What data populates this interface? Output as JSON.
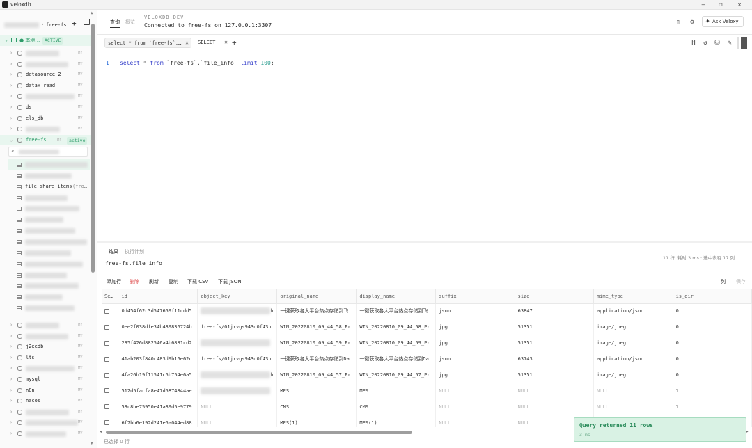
{
  "app": {
    "title": "veloxdb"
  },
  "window_controls": {
    "minimize": "—",
    "maximize": "❐",
    "close": "✕"
  },
  "sidebar": {
    "breadcrumb_db": "free-fs",
    "connection": {
      "name": "● 本地…",
      "tag": "ACTIVE"
    },
    "search_placeholder": "",
    "databases": [
      {
        "name": "",
        "blurred": true,
        "tag": "MY"
      },
      {
        "name": "",
        "blurred": true,
        "tag": "MY"
      },
      {
        "name": "datasource_2",
        "tag": "MY"
      },
      {
        "name": "datax_read",
        "tag": "MY"
      },
      {
        "name": "",
        "blurred": true,
        "tag": "MY"
      },
      {
        "name": "ds",
        "tag": "MY"
      },
      {
        "name": "els_db",
        "tag": "MY"
      },
      {
        "name": "",
        "blurred": true,
        "tag": "MY"
      },
      {
        "name": "free-fs",
        "tag": "MY",
        "active_label": "active",
        "expanded": true
      }
    ],
    "tables": [
      {
        "name": "",
        "blurred": true
      },
      {
        "name": "",
        "blurred": true
      },
      {
        "name": "file_share_items",
        "suffix": "(fro…"
      },
      {
        "name": "",
        "blurred": true
      },
      {
        "name": "",
        "blurred": true
      },
      {
        "name": "",
        "blurred": true
      },
      {
        "name": "",
        "blurred": true
      },
      {
        "name": "",
        "blurred": true
      },
      {
        "name": "",
        "blurred": true
      },
      {
        "name": "",
        "blurred": true
      },
      {
        "name": "",
        "blurred": true
      },
      {
        "name": "",
        "blurred": true
      },
      {
        "name": "",
        "blurred": true
      },
      {
        "name": "",
        "blurred": true
      }
    ],
    "databases_after": [
      {
        "name": "",
        "blurred": true,
        "tag": "MY"
      },
      {
        "name": "",
        "blurred": true,
        "tag": "MY"
      },
      {
        "name": "j2eedb",
        "tag": "MY"
      },
      {
        "name": "lts",
        "tag": "MY"
      },
      {
        "name": "",
        "blurred": true,
        "tag": "MY"
      },
      {
        "name": "mysql",
        "tag": "MY"
      },
      {
        "name": "n8n",
        "tag": "MY"
      },
      {
        "name": "nacos",
        "tag": "MY"
      },
      {
        "name": "",
        "blurred": true,
        "tag": "MY"
      },
      {
        "name": "",
        "blurred": true,
        "tag": "MY"
      },
      {
        "name": "",
        "blurred": true,
        "tag": "MY"
      }
    ]
  },
  "topbar": {
    "tab_query": "查询",
    "tab_overview": "概览",
    "brand": "VELOXDB.DEV",
    "connection_info": "Connected to free-fs on 127.0.0.1:3307",
    "ask_button": "Ask Veloxy"
  },
  "editor_tabs": [
    {
      "label": "select * from `free-fs`.…",
      "active": true
    },
    {
      "label": "SELECT",
      "active": false
    }
  ],
  "editor": {
    "line_number": "1",
    "sql_tokens": [
      {
        "t": "select",
        "c": "kw"
      },
      {
        "t": " ",
        "c": ""
      },
      {
        "t": "*",
        "c": "op"
      },
      {
        "t": " ",
        "c": ""
      },
      {
        "t": "from",
        "c": "kw"
      },
      {
        "t": " `free-fs`.`file_info` ",
        "c": ""
      },
      {
        "t": "limit",
        "c": "kw"
      },
      {
        "t": " ",
        "c": ""
      },
      {
        "t": "100",
        "c": "num"
      },
      {
        "t": ";",
        "c": ""
      }
    ]
  },
  "results": {
    "tab_results": "结果",
    "tab_plan": "执行计划",
    "title": "free-fs.file_info",
    "meta": "11 行, 耗时 3 ms · 选中表有 17 列",
    "toolbar": {
      "add_row": "添加行",
      "delete": "删除",
      "refresh": "刷新",
      "copy": "复制",
      "download_csv": "下载 CSV",
      "download_json": "下载 JSON",
      "columns": "列",
      "save": "保存"
    },
    "columns": [
      "Se…",
      "id",
      "object_key",
      "original_name",
      "display_name",
      "suffix",
      "size",
      "mime_type",
      "is_dir"
    ],
    "rows": [
      [
        "",
        "0d454f62c3d547659f11cdd5…",
        "~h…",
        "一键获取各大平台热点存储到飞…",
        "一键获取各大平台热点存储到飞…",
        "json",
        "63847",
        "application/json",
        "0"
      ],
      [
        "",
        "0ee2f038dfe34b439836724b…",
        "free-fs/01jrvgs943q0f43h…",
        "WIN_20220810_09_44_58_Pr…",
        "WIN_20220810_09_44_58_Pr…",
        "jpg",
        "51351",
        "image/jpeg",
        "0"
      ],
      [
        "",
        "235f426d882546a4b6881cd2…",
        "~",
        "WIN_20220810_09_44_59_Pr…",
        "WIN_20220810_09_44_59_Pr…",
        "jpg",
        "51351",
        "image/jpeg",
        "0"
      ],
      [
        "",
        "41ab203f840c483d9b16e62c…",
        "free-fs/01jrvgs943q0f43h…",
        "一键获取各大平台热点存储到Da…",
        "一键获取各大平台热点存储到Da…",
        "json",
        "63743",
        "application/json",
        "0"
      ],
      [
        "",
        "4fa26b19f11541c5b754e6a5…",
        "~h…",
        "WIN_20220810_09_44_57_Pr…",
        "WIN_20220810_09_44_57_Pr…",
        "jpg",
        "51351",
        "image/jpeg",
        "0"
      ],
      [
        "",
        "512d5facfa8e47d5874844ae…",
        "~",
        "MES",
        "MES",
        "NULL",
        "NULL",
        "NULL",
        "1"
      ],
      [
        "",
        "53c8be75950e41a39d5e9779…",
        "NULL",
        "CMS",
        "CMS",
        "NULL",
        "NULL",
        "NULL",
        "1"
      ],
      [
        "",
        "6f7bb6e192d241e5a044ed88…",
        "NULL",
        "MES(1)",
        "MES(1)",
        "NULL",
        "NULL",
        "NULL",
        "1"
      ]
    ],
    "status": "已选择 0 行"
  },
  "toast": {
    "message": "Query returned 11 rows",
    "time": "3 ms"
  },
  "colors": {
    "accent": "#2e9c69",
    "toast_bg": "#d9f2e4",
    "keyword": "#2a35c7",
    "delete": "#e05555"
  }
}
